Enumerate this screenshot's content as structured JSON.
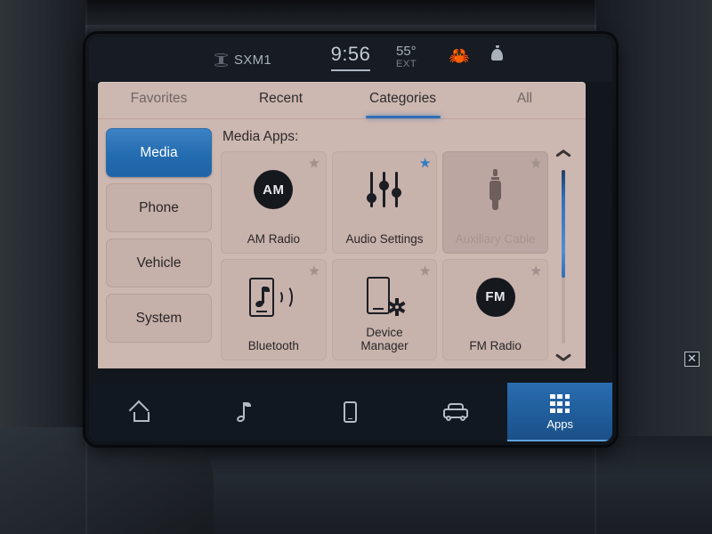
{
  "device": {
    "type": "car-infotainment-touchscreen"
  },
  "status_bar": {
    "source_icon": "satellite-radio-icon",
    "source_label": "SXM1",
    "time": "9:56",
    "temperature": "55°",
    "temperature_unit_label": "EXT",
    "crab_icon": "🦀",
    "bell_icon": "notification-bell-icon"
  },
  "tabs": [
    {
      "label": "Favorites",
      "active": false
    },
    {
      "label": "Recent",
      "active": false
    },
    {
      "label": "Categories",
      "active": true
    },
    {
      "label": "All",
      "active": false
    }
  ],
  "sidebar": {
    "items": [
      {
        "label": "Media",
        "active": true
      },
      {
        "label": "Phone",
        "active": false
      },
      {
        "label": "Vehicle",
        "active": false
      },
      {
        "label": "System",
        "active": false
      }
    ]
  },
  "content": {
    "title": "Media Apps:",
    "tiles": [
      {
        "label": "AM Radio",
        "icon": "am-radio-icon",
        "badge_text": "AM",
        "favorite": false,
        "disabled": false
      },
      {
        "label": "Audio Settings",
        "icon": "equalizer-sliders-icon",
        "favorite": true,
        "disabled": false
      },
      {
        "label": "Auxiliary Cable",
        "icon": "aux-plug-icon",
        "favorite": false,
        "disabled": true
      },
      {
        "label": "Bluetooth",
        "icon": "bluetooth-audio-phone-icon",
        "favorite": false,
        "disabled": false
      },
      {
        "label": "Device Manager",
        "label_line1": "Device",
        "label_line2": "Manager",
        "icon": "phone-gear-icon",
        "favorite": false,
        "disabled": false
      },
      {
        "label": "FM Radio",
        "icon": "fm-radio-icon",
        "badge_text": "FM",
        "favorite": false,
        "disabled": false
      }
    ]
  },
  "scrollbar": {
    "up_icon": "chevron-up-icon",
    "down_icon": "chevron-down-icon",
    "thumb_percent": 62
  },
  "bottom_nav": [
    {
      "label": "",
      "icon": "home-icon",
      "active": false
    },
    {
      "label": "",
      "icon": "music-note-icon",
      "active": false
    },
    {
      "label": "",
      "icon": "phone-icon",
      "active": false
    },
    {
      "label": "",
      "icon": "vehicle-icon",
      "active": false
    },
    {
      "label": "Apps",
      "icon": "apps-grid-icon",
      "active": true
    }
  ],
  "colors": {
    "accent_blue": "#2f6fb5",
    "panel_background": "#cdb7b1",
    "tile_background": "#c8b2ac",
    "tile_disabled_background": "#bca6a1",
    "status_bar_background": "#161b24",
    "bottom_nav_background": "#121821",
    "star_inactive": "#a2908c",
    "star_favorite": "#2f7ec4"
  }
}
